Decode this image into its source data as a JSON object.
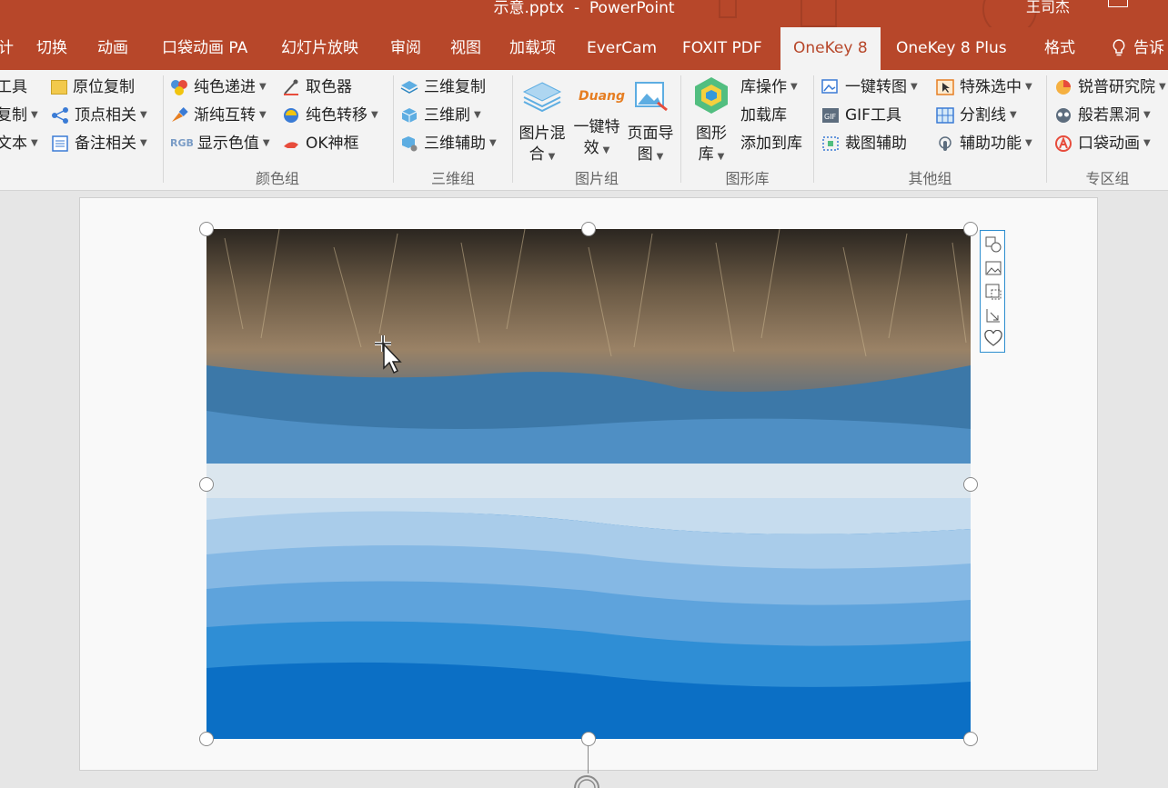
{
  "titlebar": {
    "title": "示意.pptx  -  PowerPoint",
    "user": "王司杰"
  },
  "tabs": [
    "计",
    "切换",
    "动画",
    "口袋动画 PA",
    "幻灯片放映",
    "审阅",
    "视图",
    "加载项",
    "EverCam",
    "FOXIT PDF",
    "OneKey 8",
    "OneKey 8 Plus",
    "格式",
    "告诉"
  ],
  "active_tab": "OneKey 8",
  "ribbon": {
    "col0": [
      "工具",
      "复制",
      "文本"
    ],
    "col1": [
      "原位复制",
      "顶点相关",
      "备注相关"
    ],
    "color": [
      "纯色递进",
      "渐纯互转",
      "显示色值",
      "取色器",
      "纯色转移",
      "OK神框"
    ],
    "color_label": "颜色组",
    "three_d": [
      "三维复制",
      "三维刷",
      "三维辅助"
    ],
    "three_d_label": "三维组",
    "picture": [
      {
        "l1": "图片混",
        "l2": "合"
      },
      {
        "l1": "一键特",
        "l2": "效"
      },
      {
        "l1": "页面导",
        "l2": "图"
      }
    ],
    "duang": "Duang",
    "rgb": "RGB",
    "picture_label": "图片组",
    "shape_big": {
      "l1": "图形",
      "l2": "库"
    },
    "shape_items": [
      "库操作",
      "加载库",
      "添加到库"
    ],
    "shape_label": "图形库",
    "other_a": [
      "一键转图",
      "GIF工具",
      "裁图辅助"
    ],
    "other_b": [
      "特殊选中",
      "分割线",
      "辅助功能"
    ],
    "other_label": "其他组",
    "zone": [
      "锐普研究院",
      "般若黑洞",
      "口袋动画"
    ],
    "zone_label": "专区组"
  },
  "colors": {
    "brand": "#b7472a",
    "ribbon_bg": "#f3f3f3",
    "selection": "#2d8ecf"
  }
}
